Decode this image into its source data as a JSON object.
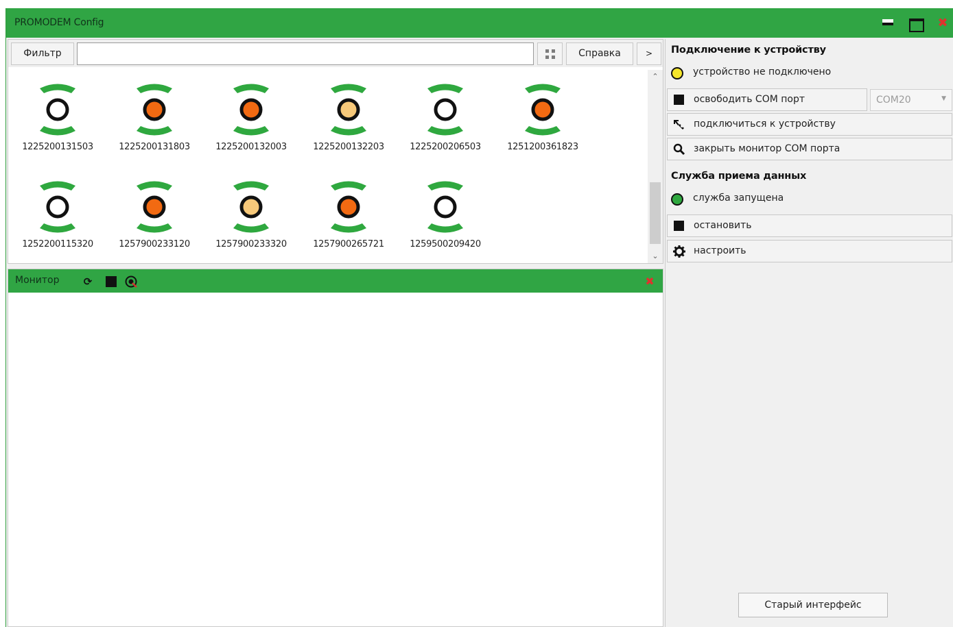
{
  "window": {
    "title": "PROMODEM Config"
  },
  "toolbar": {
    "filter_label": "Фильтр",
    "filter_value": "",
    "help_label": "Справка",
    "next_label": ">"
  },
  "devices": [
    {
      "id": "1225200131503",
      "status": "white",
      "color": "#ffffff"
    },
    {
      "id": "1225200131803",
      "status": "orange",
      "color": "#f26a12"
    },
    {
      "id": "1225200132003",
      "status": "orange",
      "color": "#f26a12"
    },
    {
      "id": "1225200132203",
      "status": "light-orange",
      "color": "#f7c97a"
    },
    {
      "id": "1225200206503",
      "status": "white",
      "color": "#ffffff"
    },
    {
      "id": "1251200361823",
      "status": "orange",
      "color": "#f26a12"
    },
    {
      "id": "1252200115320",
      "status": "white",
      "color": "#ffffff"
    },
    {
      "id": "1257900233120",
      "status": "orange",
      "color": "#f26a12"
    },
    {
      "id": "1257900233320",
      "status": "light-orange",
      "color": "#f7c97a"
    },
    {
      "id": "1257900265721",
      "status": "orange",
      "color": "#f26a12"
    },
    {
      "id": "1259500209420",
      "status": "white",
      "color": "#ffffff"
    }
  ],
  "monitor": {
    "title": "Монитор"
  },
  "connection": {
    "title": "Подключение к устройству",
    "status_text": "устройство не подключено",
    "status_color": "#f5e62b",
    "release_port_label": "освободить COM порт",
    "com_port": "COM20",
    "connect_label": "подключиться к устройству",
    "close_monitor_label": "закрыть монитор COM порта"
  },
  "service": {
    "title": "Служба приема данных",
    "status_text": "служба запущена",
    "status_color": "#2fa83f",
    "stop_label": "остановить",
    "configure_label": "настроить"
  },
  "old_interface_label": "Старый интерфейс",
  "colors": {
    "accent": "#30a544"
  }
}
